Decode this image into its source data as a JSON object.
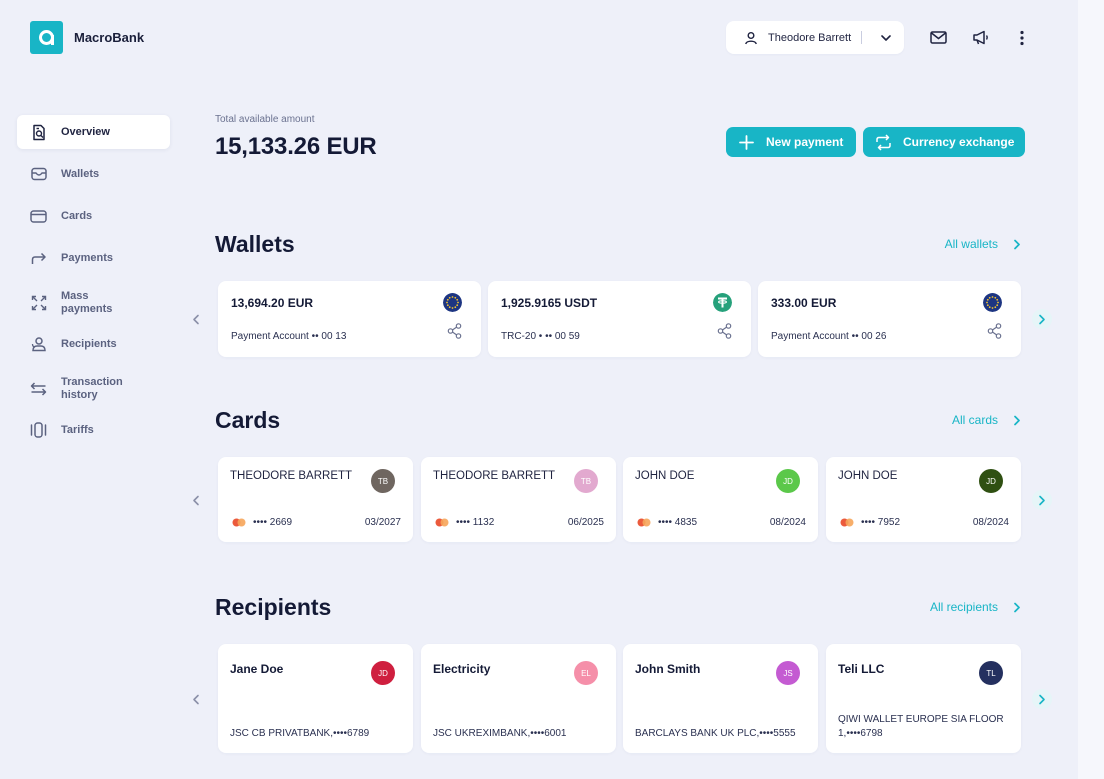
{
  "app": {
    "name": "MacroBank"
  },
  "header": {
    "user_name": "Theodore Barrett"
  },
  "sidebar": {
    "items": [
      {
        "label": "Overview",
        "icon": "overview-icon",
        "active": true
      },
      {
        "label": "Wallets",
        "icon": "wallet-icon"
      },
      {
        "label": "Cards",
        "icon": "card-icon"
      },
      {
        "label": "Payments",
        "icon": "payments-arrow-icon"
      },
      {
        "label": "Mass payments",
        "icon": "mass-payments-icon"
      },
      {
        "label": "Recipients",
        "icon": "recipients-icon"
      },
      {
        "label": "Transaction history",
        "icon": "transaction-history-icon"
      },
      {
        "label": "Tariffs",
        "icon": "tariffs-icon"
      }
    ]
  },
  "summary": {
    "label": "Total available amount",
    "amount": "15,133.26 EUR"
  },
  "actions": {
    "new_payment": "New payment",
    "currency_exchange": "Currency exchange"
  },
  "colors": {
    "accent": "#18b5c6",
    "text_dark": "#141a36",
    "background": "#eef0f9"
  },
  "wallets": {
    "title": "Wallets",
    "see_all": "All wallets",
    "items": [
      {
        "amount": "13,694.20 EUR",
        "account": "Payment Account •• 00 13",
        "currency_icon": "eur-icon"
      },
      {
        "amount": "1,925.9165 USDT",
        "account": "TRC-20 • •• 00 59",
        "currency_icon": "usdt-icon"
      },
      {
        "amount": "333.00 EUR",
        "account": "Payment Account •• 00 26",
        "currency_icon": "eur-icon"
      }
    ]
  },
  "cards": {
    "title": "Cards",
    "see_all": "All cards",
    "items": [
      {
        "holder": "THEODORE BARRETT",
        "initials": "TB",
        "number": "•••• 2669",
        "expiry": "03/2027",
        "color": "#6f6660"
      },
      {
        "holder": "THEODORE BARRETT",
        "initials": "TB",
        "number": "•••• 1132",
        "expiry": "06/2025",
        "color": "#e2a9cf"
      },
      {
        "holder": "JOHN DOE",
        "initials": "JD",
        "number": "•••• 4835",
        "expiry": "08/2024",
        "color": "#5bc84a"
      },
      {
        "holder": "JOHN DOE",
        "initials": "JD",
        "number": "•••• 7952",
        "expiry": "08/2024",
        "color": "#2f5012"
      }
    ]
  },
  "recipients": {
    "title": "Recipients",
    "see_all": "All recipients",
    "items": [
      {
        "name": "Jane Doe",
        "initials": "JD",
        "bank": "JSC CB PRIVATBANK,••••6789",
        "color": "#cf1f3f"
      },
      {
        "name": "Electricity",
        "initials": "EL",
        "bank": "JSC UKREXIMBANK,••••6001",
        "color": "#f58fa9"
      },
      {
        "name": "John Smith",
        "initials": "JS",
        "bank": "BARCLAYS BANK UK PLC,••••5555",
        "color": "#c45bd2"
      },
      {
        "name": "Teli LLC",
        "initials": "TL",
        "bank": "QIWI WALLET EUROPE SIA FLOOR 1,••••6798",
        "color": "#24305f"
      }
    ]
  }
}
